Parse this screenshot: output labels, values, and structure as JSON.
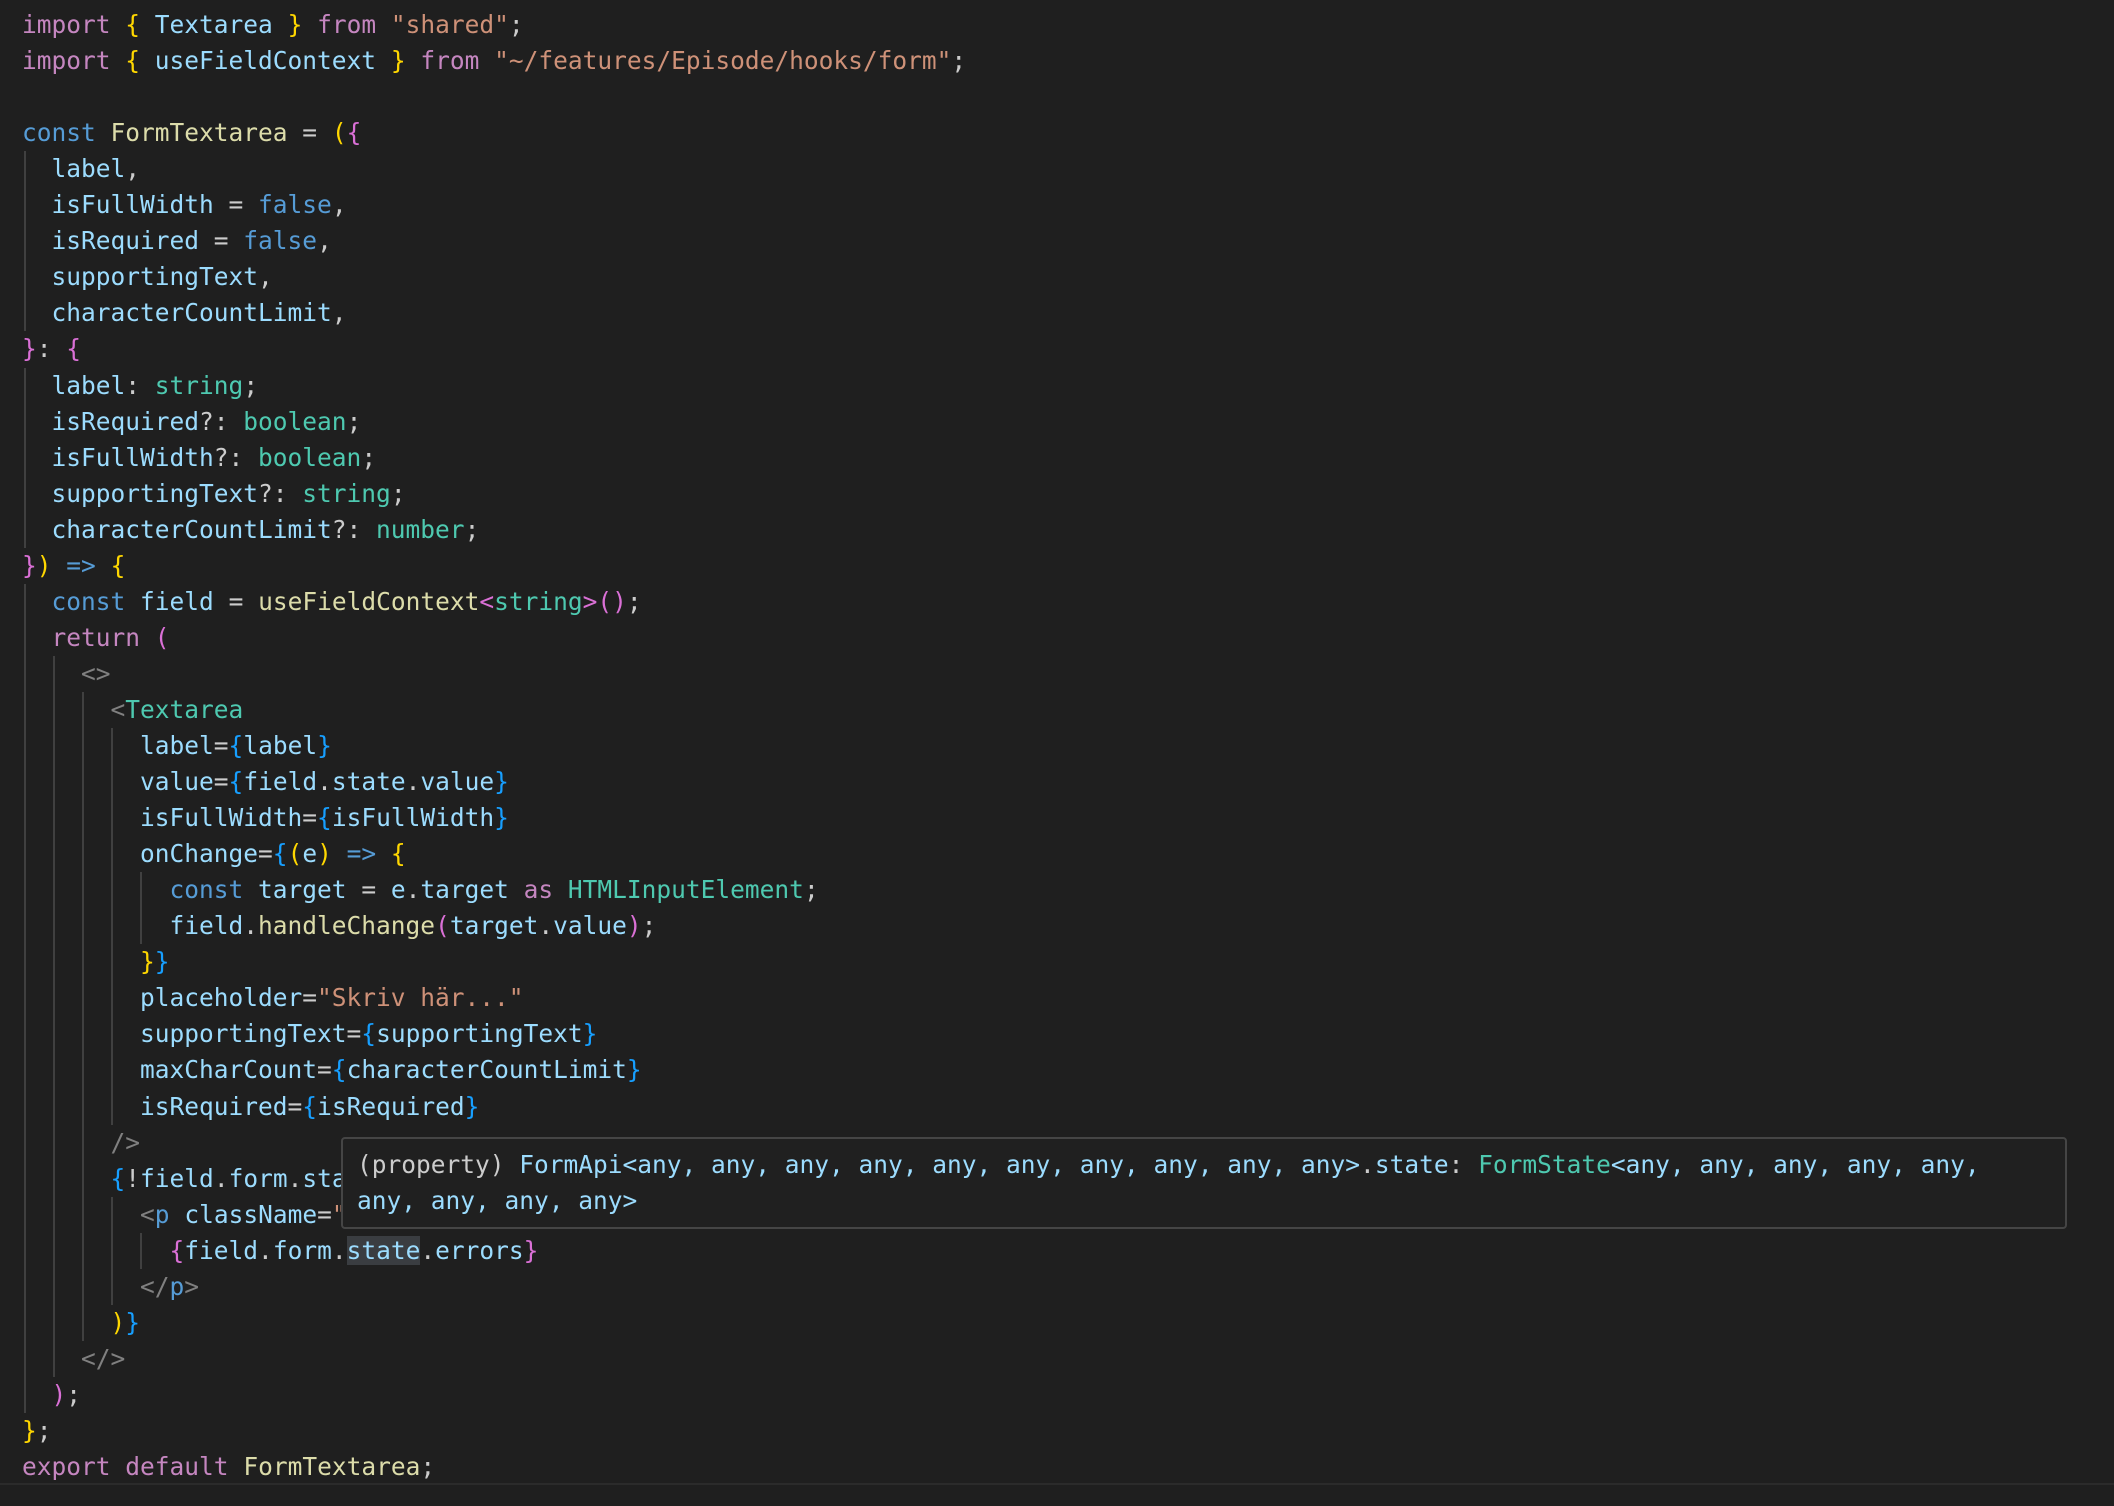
{
  "editor": {
    "lines": [
      [
        {
          "t": "import",
          "c": "kw2"
        },
        {
          "t": " "
        },
        {
          "t": "{",
          "c": "br1"
        },
        {
          "t": " Textarea",
          "c": "var"
        },
        {
          "t": " "
        },
        {
          "t": "}",
          "c": "br1"
        },
        {
          "t": " "
        },
        {
          "t": "from",
          "c": "kw2"
        },
        {
          "t": " "
        },
        {
          "t": "\"shared\"",
          "c": "str"
        },
        {
          "t": ";"
        }
      ],
      [
        {
          "t": "import",
          "c": "kw2"
        },
        {
          "t": " "
        },
        {
          "t": "{",
          "c": "br1"
        },
        {
          "t": " useFieldContext",
          "c": "var"
        },
        {
          "t": " "
        },
        {
          "t": "}",
          "c": "br1"
        },
        {
          "t": " "
        },
        {
          "t": "from",
          "c": "kw2"
        },
        {
          "t": " "
        },
        {
          "t": "\"~/features/Episode/hooks/form\"",
          "c": "str"
        },
        {
          "t": ";"
        }
      ],
      [],
      [
        {
          "t": "const",
          "c": "kw"
        },
        {
          "t": " "
        },
        {
          "t": "FormTextarea",
          "c": "fn"
        },
        {
          "t": " = "
        },
        {
          "t": "(",
          "c": "br1"
        },
        {
          "t": "{",
          "c": "br2"
        }
      ],
      [
        {
          "t": "  "
        },
        {
          "t": "label",
          "c": "var"
        },
        {
          "t": ","
        }
      ],
      [
        {
          "t": "  "
        },
        {
          "t": "isFullWidth",
          "c": "var"
        },
        {
          "t": " = "
        },
        {
          "t": "false",
          "c": "kw"
        },
        {
          "t": ","
        }
      ],
      [
        {
          "t": "  "
        },
        {
          "t": "isRequired",
          "c": "var"
        },
        {
          "t": " = "
        },
        {
          "t": "false",
          "c": "kw"
        },
        {
          "t": ","
        }
      ],
      [
        {
          "t": "  "
        },
        {
          "t": "supportingText",
          "c": "var"
        },
        {
          "t": ","
        }
      ],
      [
        {
          "t": "  "
        },
        {
          "t": "characterCountLimit",
          "c": "var"
        },
        {
          "t": ","
        }
      ],
      [
        {
          "t": "}",
          "c": "br2"
        },
        {
          "t": ": "
        },
        {
          "t": "{",
          "c": "br2"
        }
      ],
      [
        {
          "t": "  "
        },
        {
          "t": "label",
          "c": "var"
        },
        {
          "t": ": "
        },
        {
          "t": "string",
          "c": "ty"
        },
        {
          "t": ";"
        }
      ],
      [
        {
          "t": "  "
        },
        {
          "t": "isRequired",
          "c": "var"
        },
        {
          "t": "?: "
        },
        {
          "t": "boolean",
          "c": "ty"
        },
        {
          "t": ";"
        }
      ],
      [
        {
          "t": "  "
        },
        {
          "t": "isFullWidth",
          "c": "var"
        },
        {
          "t": "?: "
        },
        {
          "t": "boolean",
          "c": "ty"
        },
        {
          "t": ";"
        }
      ],
      [
        {
          "t": "  "
        },
        {
          "t": "supportingText",
          "c": "var"
        },
        {
          "t": "?: "
        },
        {
          "t": "string",
          "c": "ty"
        },
        {
          "t": ";"
        }
      ],
      [
        {
          "t": "  "
        },
        {
          "t": "characterCountLimit",
          "c": "var"
        },
        {
          "t": "?: "
        },
        {
          "t": "number",
          "c": "ty"
        },
        {
          "t": ";"
        }
      ],
      [
        {
          "t": "}",
          "c": "br2"
        },
        {
          "t": ")",
          "c": "br1"
        },
        {
          "t": " "
        },
        {
          "t": "=>",
          "c": "kw"
        },
        {
          "t": " "
        },
        {
          "t": "{",
          "c": "br1"
        }
      ],
      [
        {
          "t": "  "
        },
        {
          "t": "const",
          "c": "kw"
        },
        {
          "t": " "
        },
        {
          "t": "field",
          "c": "var"
        },
        {
          "t": " = "
        },
        {
          "t": "useFieldContext",
          "c": "fn"
        },
        {
          "t": "<",
          "c": "br2"
        },
        {
          "t": "string",
          "c": "ty"
        },
        {
          "t": ">",
          "c": "br2"
        },
        {
          "t": "()",
          "c": "br2"
        },
        {
          "t": ";"
        }
      ],
      [
        {
          "t": "  "
        },
        {
          "t": "return",
          "c": "kw2"
        },
        {
          "t": " "
        },
        {
          "t": "(",
          "c": "br2"
        }
      ],
      [
        {
          "t": "    "
        },
        {
          "t": "<>",
          "c": "tag"
        }
      ],
      [
        {
          "t": "      "
        },
        {
          "t": "<",
          "c": "tag"
        },
        {
          "t": "Textarea",
          "c": "ty"
        }
      ],
      [
        {
          "t": "        "
        },
        {
          "t": "label",
          "c": "var"
        },
        {
          "t": "="
        },
        {
          "t": "{",
          "c": "br3"
        },
        {
          "t": "label",
          "c": "var"
        },
        {
          "t": "}",
          "c": "br3"
        }
      ],
      [
        {
          "t": "        "
        },
        {
          "t": "value",
          "c": "var"
        },
        {
          "t": "="
        },
        {
          "t": "{",
          "c": "br3"
        },
        {
          "t": "field",
          "c": "var"
        },
        {
          "t": "."
        },
        {
          "t": "state",
          "c": "var"
        },
        {
          "t": "."
        },
        {
          "t": "value",
          "c": "var"
        },
        {
          "t": "}",
          "c": "br3"
        }
      ],
      [
        {
          "t": "        "
        },
        {
          "t": "isFullWidth",
          "c": "var"
        },
        {
          "t": "="
        },
        {
          "t": "{",
          "c": "br3"
        },
        {
          "t": "isFullWidth",
          "c": "var"
        },
        {
          "t": "}",
          "c": "br3"
        }
      ],
      [
        {
          "t": "        "
        },
        {
          "t": "onChange",
          "c": "var"
        },
        {
          "t": "="
        },
        {
          "t": "{",
          "c": "br3"
        },
        {
          "t": "(",
          "c": "br1"
        },
        {
          "t": "e",
          "c": "var"
        },
        {
          "t": ")",
          "c": "br1"
        },
        {
          "t": " "
        },
        {
          "t": "=>",
          "c": "kw"
        },
        {
          "t": " "
        },
        {
          "t": "{",
          "c": "br1"
        }
      ],
      [
        {
          "t": "          "
        },
        {
          "t": "const",
          "c": "kw"
        },
        {
          "t": " "
        },
        {
          "t": "target",
          "c": "var"
        },
        {
          "t": " = "
        },
        {
          "t": "e",
          "c": "var"
        },
        {
          "t": "."
        },
        {
          "t": "target",
          "c": "var"
        },
        {
          "t": " "
        },
        {
          "t": "as",
          "c": "kw2"
        },
        {
          "t": " "
        },
        {
          "t": "HTMLInputElement",
          "c": "ty"
        },
        {
          "t": ";"
        }
      ],
      [
        {
          "t": "          "
        },
        {
          "t": "field",
          "c": "var"
        },
        {
          "t": "."
        },
        {
          "t": "handleChange",
          "c": "fn"
        },
        {
          "t": "(",
          "c": "br2"
        },
        {
          "t": "target",
          "c": "var"
        },
        {
          "t": "."
        },
        {
          "t": "value",
          "c": "var"
        },
        {
          "t": ")",
          "c": "br2"
        },
        {
          "t": ";"
        }
      ],
      [
        {
          "t": "        "
        },
        {
          "t": "}",
          "c": "br1"
        },
        {
          "t": "}",
          "c": "br3"
        }
      ],
      [
        {
          "t": "        "
        },
        {
          "t": "placeholder",
          "c": "var"
        },
        {
          "t": "="
        },
        {
          "t": "\"Skriv här...\"",
          "c": "str"
        }
      ],
      [
        {
          "t": "        "
        },
        {
          "t": "supportingText",
          "c": "var"
        },
        {
          "t": "="
        },
        {
          "t": "{",
          "c": "br3"
        },
        {
          "t": "supportingText",
          "c": "var"
        },
        {
          "t": "}",
          "c": "br3"
        }
      ],
      [
        {
          "t": "        "
        },
        {
          "t": "maxCharCount",
          "c": "var"
        },
        {
          "t": "="
        },
        {
          "t": "{",
          "c": "br3"
        },
        {
          "t": "characterCountLimit",
          "c": "var"
        },
        {
          "t": "}",
          "c": "br3"
        }
      ],
      [
        {
          "t": "        "
        },
        {
          "t": "isRequired",
          "c": "var"
        },
        {
          "t": "="
        },
        {
          "t": "{",
          "c": "br3"
        },
        {
          "t": "isRequired",
          "c": "var"
        },
        {
          "t": "}",
          "c": "br3"
        }
      ],
      [
        {
          "t": "      "
        },
        {
          "t": "/>",
          "c": "tag"
        }
      ],
      [
        {
          "t": "      "
        },
        {
          "t": "{",
          "c": "br3"
        },
        {
          "t": "!"
        },
        {
          "t": "field",
          "c": "var"
        },
        {
          "t": "."
        },
        {
          "t": "form",
          "c": "var"
        },
        {
          "t": "."
        },
        {
          "t": "sta",
          "c": "var"
        }
      ],
      [
        {
          "t": "        "
        },
        {
          "t": "<",
          "c": "tag"
        },
        {
          "t": "p",
          "c": "kw"
        },
        {
          "t": " "
        },
        {
          "t": "className",
          "c": "var"
        },
        {
          "t": "="
        },
        {
          "t": "\"",
          "c": "str"
        }
      ],
      [
        {
          "t": "          "
        },
        {
          "t": "{",
          "c": "br2"
        },
        {
          "t": "field",
          "c": "var"
        },
        {
          "t": "."
        },
        {
          "t": "form",
          "c": "var"
        },
        {
          "t": "."
        },
        {
          "t": "state",
          "c": "var",
          "h": true
        },
        {
          "t": "."
        },
        {
          "t": "errors",
          "c": "var"
        },
        {
          "t": "}",
          "c": "br2"
        }
      ],
      [
        {
          "t": "        "
        },
        {
          "t": "</",
          "c": "tag"
        },
        {
          "t": "p",
          "c": "kw"
        },
        {
          "t": ">",
          "c": "tag"
        }
      ],
      [
        {
          "t": "      "
        },
        {
          "t": ")",
          "c": "br1"
        },
        {
          "t": "}",
          "c": "br3"
        }
      ],
      [
        {
          "t": "    "
        },
        {
          "t": "</>",
          "c": "tag"
        }
      ],
      [
        {
          "t": "  "
        },
        {
          "t": ")",
          "c": "br2"
        },
        {
          "t": ";"
        }
      ],
      [
        {
          "t": "}",
          "c": "br1"
        },
        {
          "t": ";"
        }
      ],
      [
        {
          "t": "export",
          "c": "kw2"
        },
        {
          "t": " "
        },
        {
          "t": "default",
          "c": "kw2"
        },
        {
          "t": " "
        },
        {
          "t": "FormTextarea",
          "c": "fn"
        },
        {
          "t": ";"
        }
      ]
    ]
  },
  "hover": {
    "segments": [
      {
        "t": "(property) ",
        "c": "txt"
      },
      {
        "t": "FormApi",
        "c": "var"
      },
      {
        "t": "<any, any, any, any, any, any, any, any, any, any>",
        "c": "var"
      },
      {
        "t": ".",
        "c": "txt"
      },
      {
        "t": "state",
        "c": "var"
      },
      {
        "t": ": ",
        "c": "txt"
      },
      {
        "t": "FormState",
        "c": "ty"
      },
      {
        "t": "<any, any, any, any, any, any, any, any, any>",
        "c": "var"
      }
    ]
  },
  "colors": {
    "background": "#1f1f1f",
    "keyword": "#569cd6",
    "control_keyword": "#c586c0",
    "type": "#4ec9b0",
    "string": "#ce9178",
    "variable": "#9cdcfe",
    "function": "#dcdcaa",
    "bracket_1": "#ffd700",
    "bracket_2": "#da70d6",
    "bracket_3": "#179fff"
  }
}
